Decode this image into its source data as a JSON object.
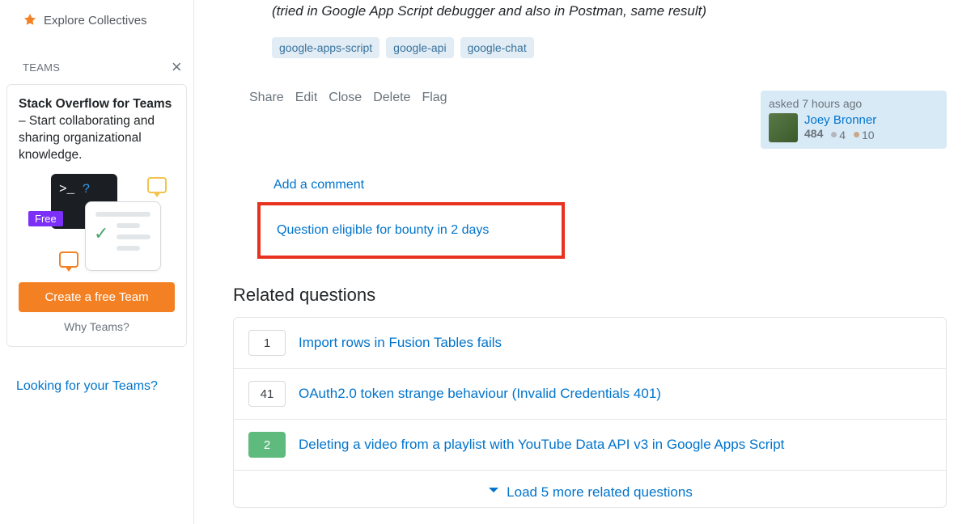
{
  "sidebar": {
    "explore_label": "Explore Collectives",
    "teams_header": "TEAMS",
    "teams_blurb_bold": "Stack Overflow for Teams",
    "teams_blurb_rest": " – Start collaborating and sharing organizational knowledge.",
    "free_badge": "Free",
    "create_team_label": "Create a free Team",
    "why_teams_label": "Why Teams?",
    "looking_link": "Looking for your Teams?"
  },
  "question": {
    "note": "(tried in Google App Script debugger and also in Postman, same result)",
    "tags": [
      "google-apps-script",
      "google-api",
      "google-chat"
    ],
    "actions": [
      "Share",
      "Edit",
      "Close",
      "Delete",
      "Flag"
    ],
    "usercard": {
      "asked": "asked 7 hours ago",
      "name": "Joey Bronner",
      "rep": "484",
      "silver": "4",
      "bronze": "10"
    },
    "add_comment": "Add a comment",
    "bounty_text": "Question eligible for bounty in 2 days"
  },
  "related": {
    "title": "Related questions",
    "items": [
      {
        "score": "1",
        "answered": false,
        "title": "Import rows in Fusion Tables fails"
      },
      {
        "score": "41",
        "answered": false,
        "title": "OAuth2.0 token strange behaviour (Invalid Credentials 401)"
      },
      {
        "score": "2",
        "answered": true,
        "title": "Deleting a video from a playlist with YouTube Data API v3 in Google Apps Script"
      }
    ],
    "load_more": "Load 5 more related questions"
  }
}
